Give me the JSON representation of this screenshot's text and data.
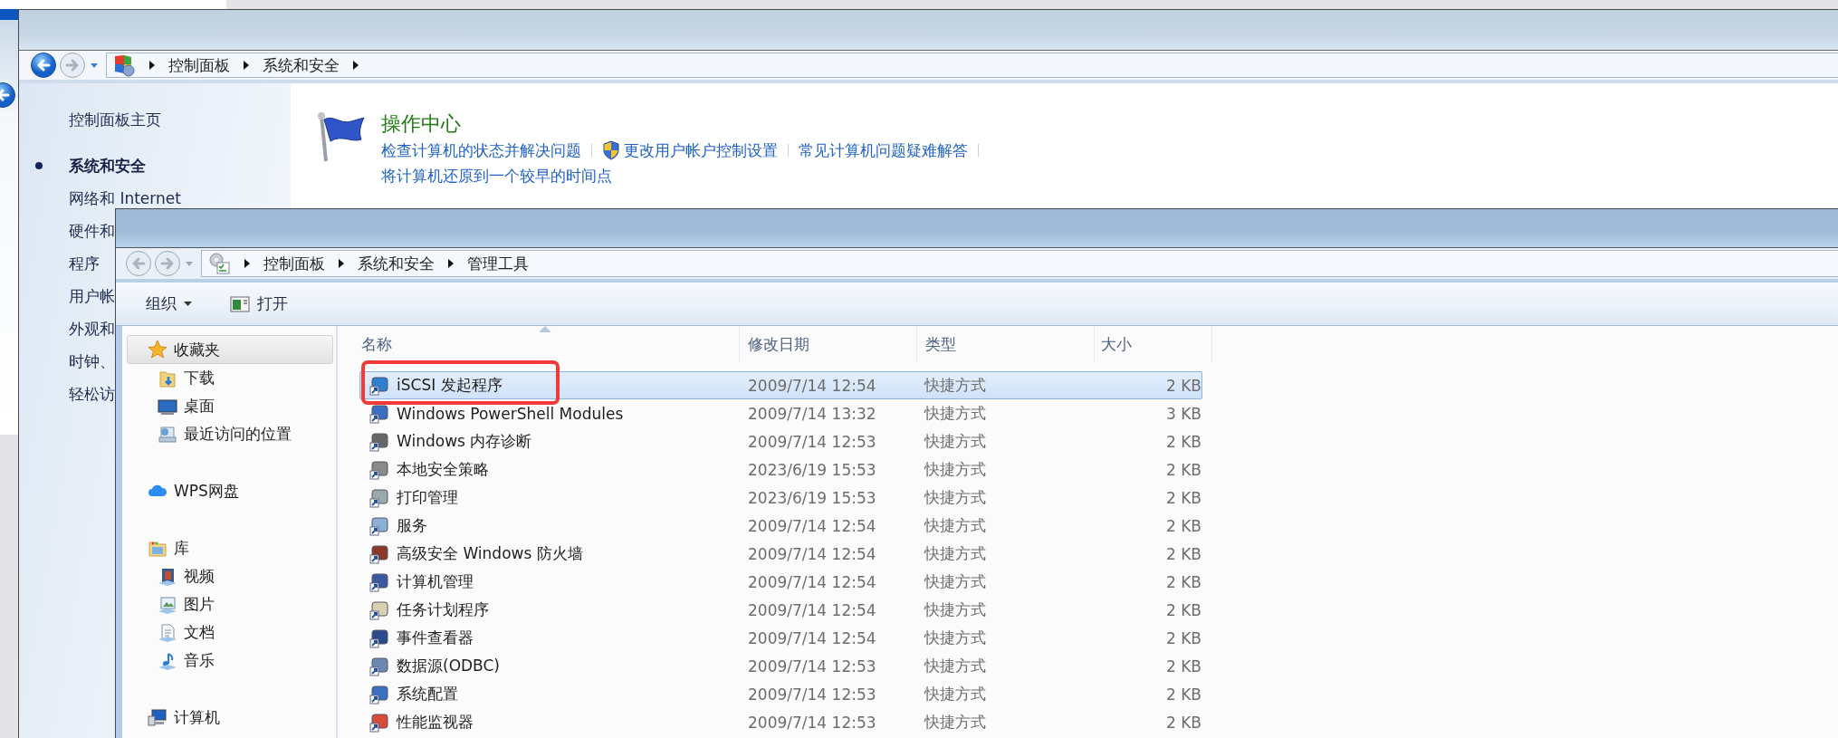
{
  "control_panel_window": {
    "nav": {
      "back_enabled": true
    },
    "address_path": [
      "控制面板",
      "系统和安全"
    ],
    "sidebar": {
      "items": [
        {
          "label": "控制面板主页",
          "selected": false
        },
        {
          "label": "系统和安全",
          "selected": true
        },
        {
          "label": "网络和 Internet",
          "selected": false
        },
        {
          "label": "硬件和",
          "selected": false
        },
        {
          "label": "程序",
          "selected": false
        },
        {
          "label": "用户帐",
          "selected": false
        },
        {
          "label": "外观和",
          "selected": false
        },
        {
          "label": "时钟、",
          "selected": false
        },
        {
          "label": "轻松访",
          "selected": false
        }
      ]
    },
    "section": {
      "title": "操作中心",
      "link_rows": [
        [
          {
            "text": "检查计算机的状态并解决问题",
            "kind": "plain"
          },
          {
            "text": "更改用户帐户控制设置",
            "kind": "shield"
          },
          {
            "text": "常见计算机问题疑难解答",
            "kind": "plain"
          }
        ],
        [
          {
            "text": "将计算机还原到一个较早的时间点",
            "kind": "plain"
          }
        ]
      ]
    }
  },
  "explorer_window": {
    "nav": {
      "back_enabled": false
    },
    "address_path": [
      "控制面板",
      "系统和安全",
      "管理工具"
    ],
    "toolbar": [
      {
        "label": "组织",
        "kind": "menu"
      },
      {
        "label": "打开",
        "kind": "open"
      }
    ],
    "nav_groups": [
      {
        "label": "收藏夹",
        "kind": "star",
        "selected": true,
        "children": [
          {
            "label": "下载",
            "kind": "folder"
          },
          {
            "label": "桌面",
            "kind": "desktop"
          },
          {
            "label": "最近访问的位置",
            "kind": "recent"
          }
        ]
      },
      {
        "label": "WPS网盘",
        "kind": "cloud",
        "selected": false
      },
      {
        "label": "库",
        "kind": "library",
        "selected": false,
        "children": [
          {
            "label": "视频",
            "kind": "video"
          },
          {
            "label": "图片",
            "kind": "picture"
          },
          {
            "label": "文档",
            "kind": "document"
          },
          {
            "label": "音乐",
            "kind": "music"
          }
        ]
      },
      {
        "label": "计算机",
        "kind": "computer",
        "selected": false
      }
    ],
    "columns": [
      "名称",
      "修改日期",
      "类型",
      "大小"
    ],
    "rows": [
      {
        "name": "iSCSI 发起程序",
        "modified": "2009/7/14 12:54",
        "type": "快捷方式",
        "size": "2 KB",
        "selected": true
      },
      {
        "name": "Windows PowerShell Modules",
        "modified": "2009/7/14 13:32",
        "type": "快捷方式",
        "size": "3 KB",
        "selected": false
      },
      {
        "name": "Windows 内存诊断",
        "modified": "2009/7/14 12:53",
        "type": "快捷方式",
        "size": "2 KB",
        "selected": false
      },
      {
        "name": "本地安全策略",
        "modified": "2023/6/19 15:53",
        "type": "快捷方式",
        "size": "2 KB",
        "selected": false
      },
      {
        "name": "打印管理",
        "modified": "2023/6/19 15:53",
        "type": "快捷方式",
        "size": "2 KB",
        "selected": false
      },
      {
        "name": "服务",
        "modified": "2009/7/14 12:54",
        "type": "快捷方式",
        "size": "2 KB",
        "selected": false
      },
      {
        "name": "高级安全 Windows 防火墙",
        "modified": "2009/7/14 12:54",
        "type": "快捷方式",
        "size": "2 KB",
        "selected": false
      },
      {
        "name": "计算机管理",
        "modified": "2009/7/14 12:54",
        "type": "快捷方式",
        "size": "2 KB",
        "selected": false
      },
      {
        "name": "任务计划程序",
        "modified": "2009/7/14 12:54",
        "type": "快捷方式",
        "size": "2 KB",
        "selected": false
      },
      {
        "name": "事件查看器",
        "modified": "2009/7/14 12:54",
        "type": "快捷方式",
        "size": "2 KB",
        "selected": false
      },
      {
        "name": "数据源(ODBC)",
        "modified": "2009/7/14 12:53",
        "type": "快捷方式",
        "size": "2 KB",
        "selected": false
      },
      {
        "name": "系统配置",
        "modified": "2009/7/14 12:53",
        "type": "快捷方式",
        "size": "2 KB",
        "selected": false
      },
      {
        "name": "性能监视器",
        "modified": "2009/7/14 12:53",
        "type": "快捷方式",
        "size": "2 KB",
        "selected": false
      }
    ]
  }
}
